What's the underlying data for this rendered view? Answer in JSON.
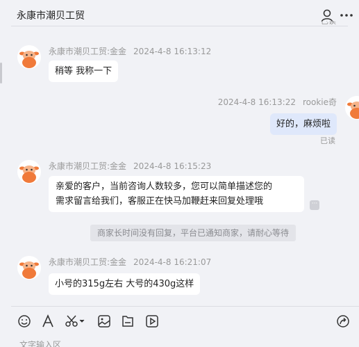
{
  "header": {
    "title": "永康市潮贝工贸",
    "clipped_read": "已读"
  },
  "messages": [
    {
      "sender": "永康市潮贝工贸:金金",
      "time": "2024-4-8 16:13:12",
      "text": "稍等  我称一下"
    },
    {
      "sender": "rookie奇",
      "time": "2024-4-8 16:13:22",
      "text": "好的，麻烦啦",
      "status": "已读"
    },
    {
      "sender": "永康市潮贝工贸:金金",
      "time": "2024-4-8 16:15:23",
      "line1": "亲爱的客户，当前咨询人数较多，您可以简单描述您的",
      "line2": "需求留言给我们，客服正在快马加鞭赶来回复处理哦",
      "more": "···"
    },
    {
      "sender": "永康市潮贝工贸:金金",
      "time": "2024-4-8 16:21:07",
      "text": "小号的315g左右 大号的430g这样"
    }
  ],
  "system_notice": "商家长时间没有回复，平台已通知商家，请耐心等待",
  "composer": {
    "placeholder": "文字输入区",
    "tools": [
      "emoji-icon",
      "font-icon",
      "scissors-icon",
      "image-icon",
      "file-icon",
      "video-icon",
      "share-icon"
    ]
  },
  "colors": {
    "background": "#f1f2f6",
    "my_bubble": "#dfe8fb",
    "their_bubble": "#ffffff",
    "avatar_orange": "#f07a3a"
  }
}
